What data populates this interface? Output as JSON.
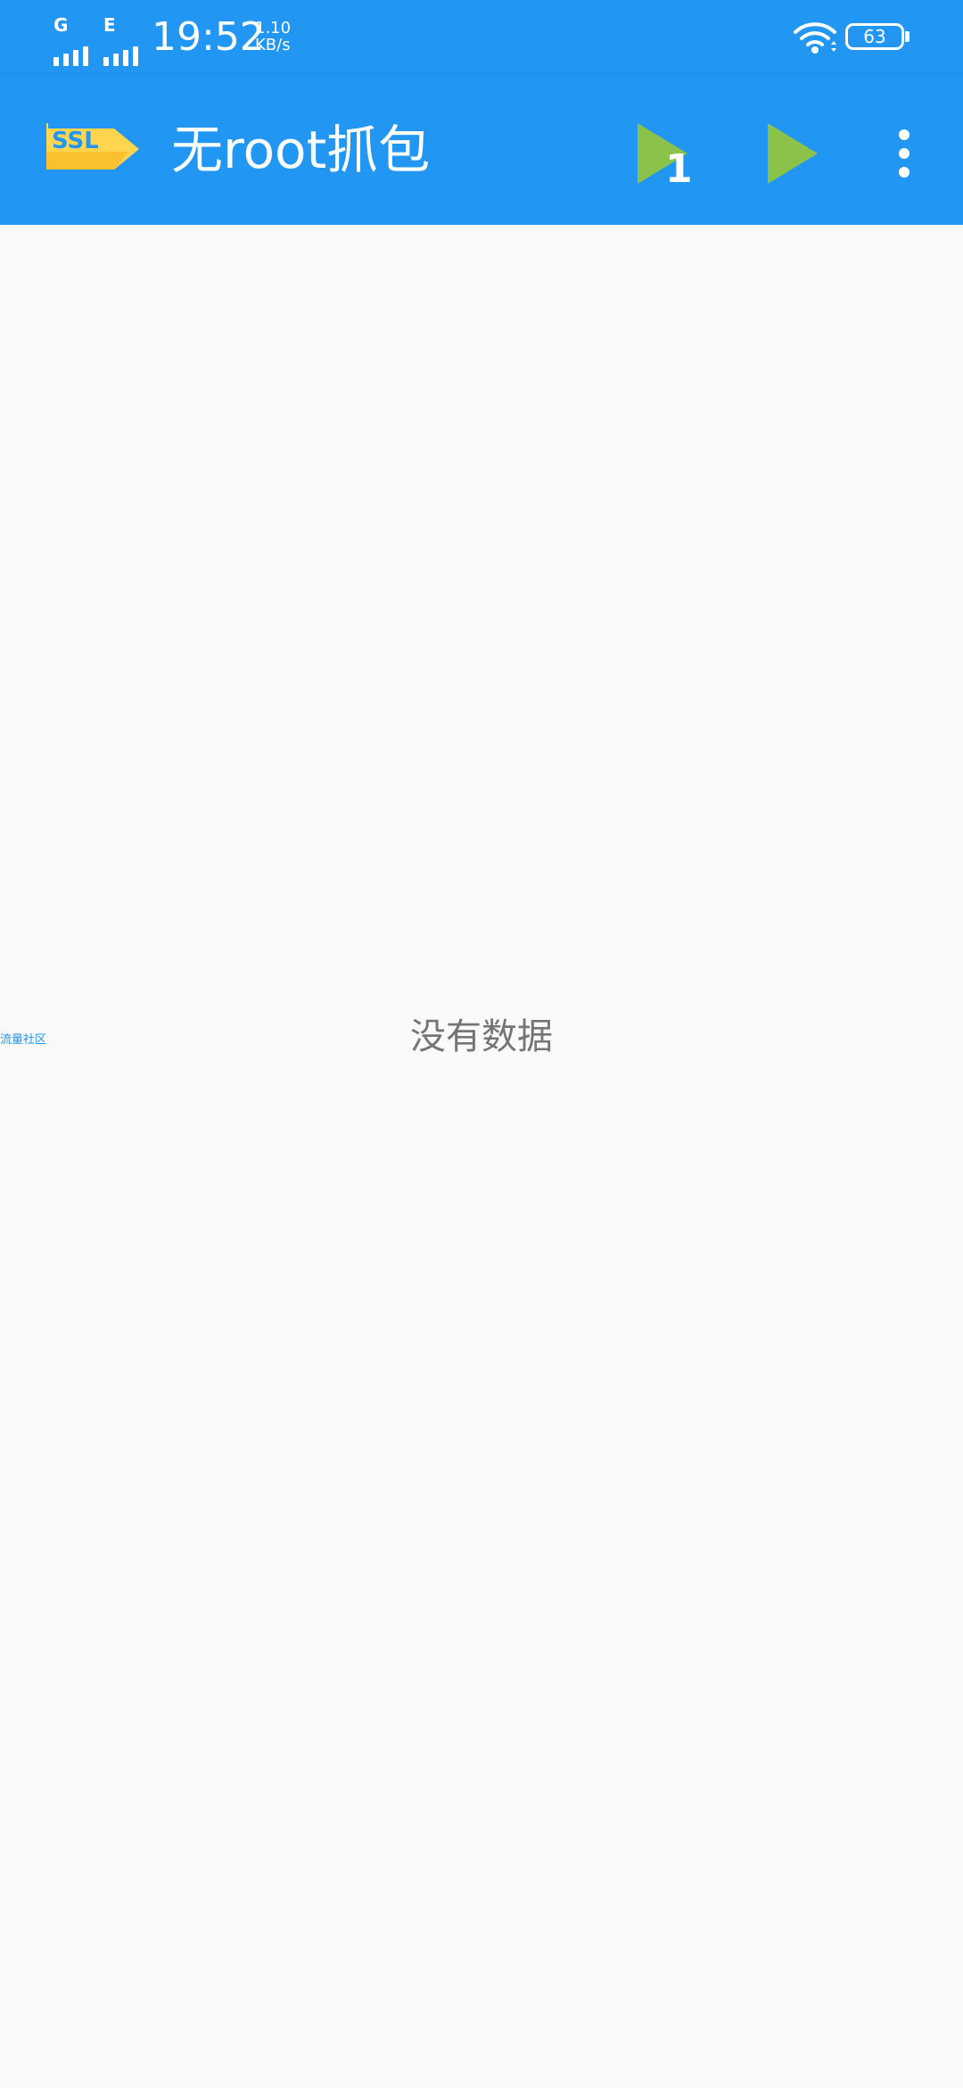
{
  "status_bar": {
    "sim1_network": "G",
    "sim2_network": "E",
    "time": "19:52",
    "speed_value": "1.10",
    "speed_unit": "KB/s",
    "battery_level": "63",
    "icons": [
      "signal-icon",
      "wifi-icon",
      "battery-icon"
    ]
  },
  "app_bar": {
    "title": "无root抓包",
    "logo_text": "SSL",
    "actions": [
      {
        "name": "start-single",
        "icon": "play-icon",
        "badge": "1"
      },
      {
        "name": "start",
        "icon": "play-icon"
      },
      {
        "name": "more",
        "icon": "more-vertical-icon"
      }
    ]
  },
  "content": {
    "empty_message": "没有数据",
    "side_link": "流量社区"
  },
  "colors": {
    "primary": "#2196f3",
    "play_green": "#8bc34a",
    "logo_yellow": "#ffd54f",
    "background": "#fafafa",
    "empty_text": "#757575"
  }
}
